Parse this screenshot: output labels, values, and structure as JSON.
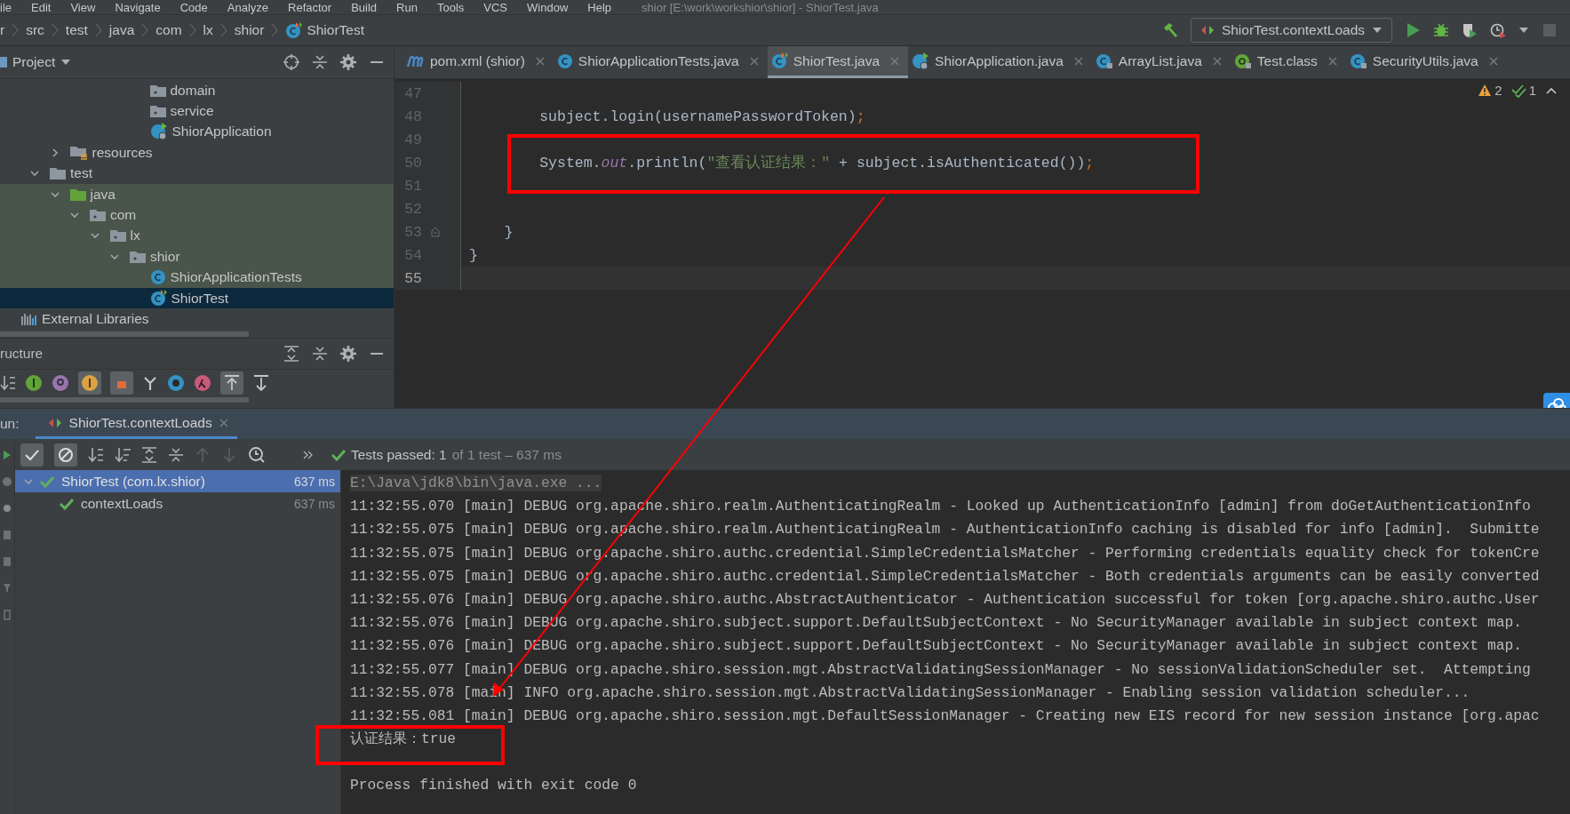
{
  "menu": [
    "ile",
    "Edit",
    "View",
    "Navigate",
    "Code",
    "Analyze",
    "Refactor",
    "Build",
    "Run",
    "Tools",
    "VCS",
    "Window",
    "Help"
  ],
  "window_title": "shior [E:\\work\\workshior\\shior] - ShiorTest.java",
  "breadcrumb": [
    {
      "label": "r",
      "kind": "text"
    },
    {
      "label": "src",
      "kind": "text"
    },
    {
      "label": "test",
      "kind": "text"
    },
    {
      "label": "java",
      "kind": "text"
    },
    {
      "label": "com",
      "kind": "text"
    },
    {
      "label": "lx",
      "kind": "text"
    },
    {
      "label": "shior",
      "kind": "text"
    },
    {
      "label": "ShiorTest",
      "kind": "test-class"
    }
  ],
  "run_config": {
    "label": "ShiorTest.contextLoads"
  },
  "project_panel": {
    "title": "Project",
    "tree": [
      {
        "children": [
          {
            "children": [
              {
                "children": [
                  {
                    "children": [
                      {
                        "children": [
                          {
                            "children": [
                              {
                                "children": [
                                  {
                                    "label": "domain",
                                    "kind": "package",
                                    "selected": false
                                  },
                                  {
                                    "label": "service",
                                    "kind": "package",
                                    "selected": false
                                  },
                                  {
                                    "label": "ShiorApplication",
                                    "kind": "app-class",
                                    "selected": false
                                  }
                                ]
                              }
                            ]
                          }
                        ]
                      }
                    ]
                  },
                  {
                    "label": "resources",
                    "kind": "resources",
                    "expanded": false,
                    "selected": false
                  }
                ]
              },
              {
                "label": "test",
                "kind": "folder",
                "expanded": true,
                "selected": false,
                "children": [
                  {
                    "label": "java",
                    "kind": "test-root",
                    "expanded": true,
                    "selected": false,
                    "children": [
                      {
                        "label": "com",
                        "kind": "package",
                        "expanded": true,
                        "selected": false,
                        "children": [
                          {
                            "label": "lx",
                            "kind": "package",
                            "expanded": true,
                            "selected": false,
                            "children": [
                              {
                                "label": "shior",
                                "kind": "package",
                                "expanded": true,
                                "selected": false,
                                "children": [
                                  {
                                    "label": "ShiorApplicationTests",
                                    "kind": "class",
                                    "selected": false
                                  },
                                  {
                                    "label": "ShiorTest",
                                    "kind": "test-class",
                                    "selected": true
                                  }
                                ]
                              }
                            ]
                          }
                        ]
                      }
                    ]
                  }
                ]
              }
            ]
          }
        ]
      },
      {
        "label": "External Libraries",
        "kind": "library",
        "selected": false
      }
    ]
  },
  "structure_panel": {
    "title": "ructure"
  },
  "editor": {
    "tabs": [
      {
        "label": "pom.xml (shior)",
        "kind": "maven",
        "selected": false
      },
      {
        "label": "ShiorApplicationTests.java",
        "kind": "class",
        "selected": false
      },
      {
        "label": "ShiorTest.java",
        "kind": "test-class",
        "selected": true
      },
      {
        "label": "ShiorApplication.java",
        "kind": "app-class",
        "selected": false
      },
      {
        "label": "ArrayList.java",
        "kind": "class-locked",
        "selected": false
      },
      {
        "label": "Test.class",
        "kind": "annotation-locked",
        "selected": false
      },
      {
        "label": "SecurityUtils.java",
        "kind": "class-locked",
        "selected": false
      }
    ],
    "inspections": {
      "warnings": "2",
      "checks": "1"
    },
    "lines": [
      {
        "number": "47",
        "current": false
      },
      {
        "number": "48",
        "current": false,
        "tokens": [
          {
            "t": "        subject.login(usernamePasswordToken)",
            "kind": "plain"
          },
          {
            "t": ";",
            "kind": "punct"
          }
        ]
      },
      {
        "number": "49",
        "current": false
      },
      {
        "number": "50",
        "current": false,
        "tokens": [
          {
            "t": "        System.",
            "kind": "plain"
          },
          {
            "t": "out",
            "kind": "field"
          },
          {
            "t": ".println(",
            "kind": "plain"
          },
          {
            "t": "\"查看认证结果：\"",
            "kind": "string"
          },
          {
            "t": " + subject.isAuthenticated())",
            "kind": "plain"
          },
          {
            "t": ";",
            "kind": "punct"
          }
        ]
      },
      {
        "number": "51",
        "current": false
      },
      {
        "number": "52",
        "current": false
      },
      {
        "number": "53",
        "current": false,
        "fold": true,
        "tokens": [
          {
            "t": "    }",
            "kind": "plain"
          }
        ]
      },
      {
        "number": "54",
        "current": false,
        "tokens": [
          {
            "t": "}",
            "kind": "plain"
          }
        ]
      },
      {
        "number": "55",
        "current": true
      }
    ]
  },
  "run_panel": {
    "label": "un:",
    "tab": {
      "label": "ShiorTest.contextLoads",
      "selected": true
    },
    "status": {
      "passed": "Tests passed: 1",
      "detail": "of 1 test – 637 ms"
    },
    "tests": [
      {
        "label": "ShiorTest (com.lx.shior)",
        "time": "637 ms",
        "passed": true,
        "selected": true,
        "expanded": true,
        "children": [
          {
            "label": "contextLoads",
            "time": "637 ms",
            "passed": true,
            "selected": false
          }
        ]
      }
    ],
    "console": [
      {
        "kind": "command",
        "text": "E:\\Java\\jdk8\\bin\\java.exe ..."
      },
      {
        "kind": "log",
        "text": "11:32:55.070 [main] DEBUG org.apache.shiro.realm.AuthenticatingRealm - Looked up AuthenticationInfo [admin] from doGetAuthenticationInfo"
      },
      {
        "kind": "log",
        "text": "11:32:55.075 [main] DEBUG org.apache.shiro.realm.AuthenticatingRealm - AuthenticationInfo caching is disabled for info [admin].  Submitte"
      },
      {
        "kind": "log",
        "text": "11:32:55.075 [main] DEBUG org.apache.shiro.authc.credential.SimpleCredentialsMatcher - Performing credentials equality check for tokenCre"
      },
      {
        "kind": "log",
        "text": "11:32:55.075 [main] DEBUG org.apache.shiro.authc.credential.SimpleCredentialsMatcher - Both credentials arguments can be easily converted"
      },
      {
        "kind": "log",
        "text": "11:32:55.076 [main] DEBUG org.apache.shiro.authc.AbstractAuthenticator - Authentication successful for token [org.apache.shiro.authc.User"
      },
      {
        "kind": "log",
        "text": "11:32:55.076 [main] DEBUG org.apache.shiro.subject.support.DefaultSubjectContext - No SecurityManager available in subject context map."
      },
      {
        "kind": "log",
        "text": "11:32:55.076 [main] DEBUG org.apache.shiro.subject.support.DefaultSubjectContext - No SecurityManager available in subject context map."
      },
      {
        "kind": "log",
        "text": "11:32:55.077 [main] DEBUG org.apache.shiro.session.mgt.AbstractValidatingSessionManager - No sessionValidationScheduler set.  Attempting"
      },
      {
        "kind": "log",
        "text": "11:32:55.078 [main] INFO org.apache.shiro.session.mgt.AbstractValidatingSessionManager - Enabling session validation scheduler..."
      },
      {
        "kind": "log",
        "text": "11:32:55.081 [main] DEBUG org.apache.shiro.session.mgt.DefaultSessionManager - Creating new EIS record for new session instance [org.apac"
      },
      {
        "kind": "output",
        "text": "认证结果：true"
      },
      {
        "kind": "exit",
        "text": "Process finished with exit code 0"
      }
    ]
  },
  "annotations": [
    {
      "kind": "box"
    },
    {
      "kind": "box"
    },
    {
      "kind": "arrow"
    }
  ]
}
